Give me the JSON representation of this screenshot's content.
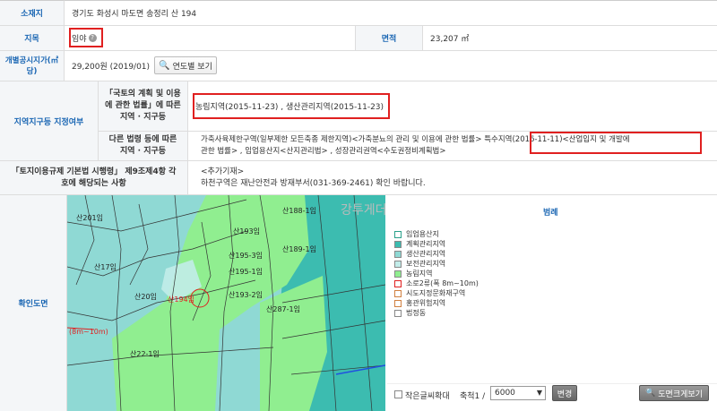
{
  "location": {
    "label": "소재지",
    "value": "경기도 화성시 마도면 송정리 산 194"
  },
  "jimok": {
    "label": "지목",
    "value": "임야"
  },
  "area": {
    "label": "면적",
    "value": "23,207 ㎡"
  },
  "price": {
    "label": "개별공시지가(㎡당)",
    "value": "29,200원 (2019/01)",
    "button": "연도별 보기"
  },
  "zone": {
    "label": "지역지구등 지정여부",
    "row1_label": "「국토의 계획 및 이용에 관한 법률」에 따른 지역 · 지구등",
    "row1_value": "농림지역(2015-11-23) , 생산관리지역(2015-11-23)",
    "row2_label": "다른 법령 등에 따른 지역 · 지구등",
    "row2_value_a": "가축사육제한구역(일부제한 모든축종 제한지역)<가축분뇨의 관리 및 이용에 관한 법률> ",
    "row2_value_b": "특수지역(2016-11-11)<산업입지 및 개발에",
    "row2_value_c": "관한 법률> , 임업용산지<산지관리법> , 성장관리권역<수도권정비계획법>"
  },
  "regulation": {
    "label": "「토지이용규제 기본법 시행령」 제9조제4항 각 호에 해당되는 사항",
    "line1": "<추가기재>",
    "line2": "하천구역은 재난안전과 방재부서(031-369-2461) 확인 바랍니다."
  },
  "map": {
    "label": "확인도면",
    "watermark": "강투게더 메리크리스마스~",
    "legend_title": "범례",
    "legend": [
      {
        "name": "임업용산지",
        "color": "#ffffff",
        "border": "#2aa08a"
      },
      {
        "name": "계획관리지역",
        "color": "#3cbcb0",
        "border": "#888"
      },
      {
        "name": "생산관리지역",
        "color": "#8fd9d4",
        "border": "#888"
      },
      {
        "name": "보전관리지역",
        "color": "#c2ece9",
        "border": "#888"
      },
      {
        "name": "농림지역",
        "color": "#90ee90",
        "border": "#888"
      },
      {
        "name": "소로2류(폭 8m~10m)",
        "color": "#ffffff",
        "border": "#e02020"
      },
      {
        "name": "시도지정문화재구역",
        "color": "#ffffff",
        "border": "#d08040"
      },
      {
        "name": "홍관위험지역",
        "color": "#ffffff",
        "border": "#d08040"
      },
      {
        "name": "법정동",
        "color": "#ffffff",
        "border": "#888"
      }
    ],
    "parcels": [
      "산188-1임",
      "산193임",
      "산17임",
      "산189-1임",
      "산195-3임",
      "산195-1임",
      "산20임",
      "산193-2임",
      "산287-1임",
      "산22-1임",
      "산201임"
    ],
    "target": "산194임",
    "road_label": "(8m~10m)",
    "checkbox_label": "작은글씨확대",
    "scale_label": "축척1 /",
    "scale_value": "6000",
    "change_button": "변경",
    "print_button": "도면크게보기"
  }
}
